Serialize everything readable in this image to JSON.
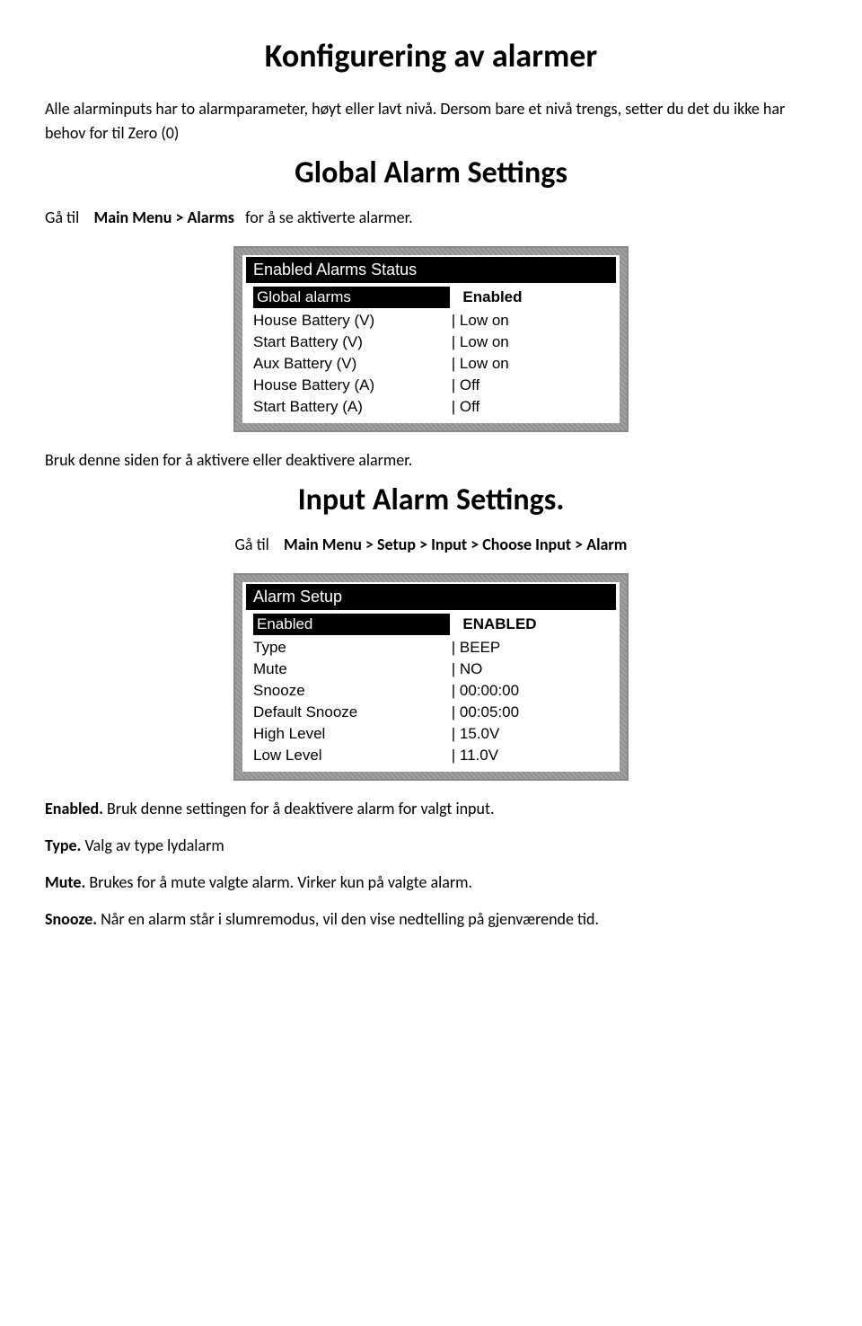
{
  "heading_main": "Konfigurering av alarmer",
  "intro": "Alle alarminputs har to alarmparameter, høyt eller lavt nivå. Dersom bare et nivå trengs, setter du det du ikke har behov for til Zero (0)",
  "section1": {
    "title": "Global Alarm Settings",
    "nav_prefix": "Gå til",
    "nav_path": "Main Menu > Alarms",
    "nav_suffix": "for  å se aktiverte alarmer.",
    "panel_title": "Enabled Alarms Status",
    "rows": [
      {
        "label": "Global alarms",
        "value": "Enabled",
        "hl": true
      },
      {
        "label": "House Battery (V)",
        "value": "Low on"
      },
      {
        "label": "Start Battery (V)",
        "value": "Low on"
      },
      {
        "label": "Aux Battery (V)",
        "value": "Low on"
      },
      {
        "label": "House Battery (A)",
        "value": "Off"
      },
      {
        "label": "Start Battery (A)",
        "value": "Off"
      }
    ],
    "after": "Bruk denne siden for å aktivere eller deaktivere alarmer."
  },
  "section2": {
    "title": "Input Alarm Settings.",
    "nav_prefix": "Gå til",
    "nav_path": "Main Menu > Setup > Input > Choose Input > Alarm",
    "panel_title": "Alarm Setup",
    "rows": [
      {
        "label": "Enabled",
        "value": "ENABLED",
        "hl": true
      },
      {
        "label": "Type",
        "value": "BEEP"
      },
      {
        "label": "Mute",
        "value": "NO"
      },
      {
        "label": "Snooze",
        "value": "00:00:00"
      },
      {
        "label": "Default Snooze",
        "value": "00:05:00"
      },
      {
        "label": "High Level",
        "value": "15.0V"
      },
      {
        "label": "Low Level",
        "value": "11.0V"
      }
    ]
  },
  "defs": [
    {
      "term": "Enabled.",
      "text": " Bruk denne settingen for å deaktivere alarm for valgt input."
    },
    {
      "term": "Type.",
      "text": "  Valg av type lydalarm"
    },
    {
      "term": "Mute.",
      "text": "  Brukes for å mute valgte alarm. Virker kun på valgte alarm."
    },
    {
      "term": "Snooze.",
      "text": "  Når en alarm står i slumremodus, vil den vise nedtelling på gjenværende tid."
    }
  ]
}
